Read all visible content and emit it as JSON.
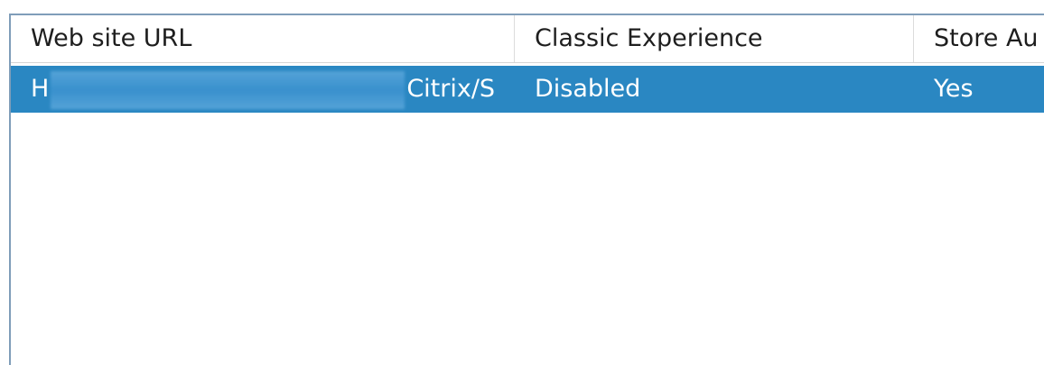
{
  "columns": {
    "col1_label": "Web site URL",
    "col2_label": "Classic Experience",
    "col3_label": "Store Au"
  },
  "rows": [
    {
      "url_prefix": "H",
      "url_suffix": "Citrix/S",
      "classic_experience": "Disabled",
      "store_auth": "Yes"
    }
  ],
  "colors": {
    "selection_bg": "#2a87c2",
    "selection_text": "#ffffff",
    "border": "#7f9db9"
  }
}
